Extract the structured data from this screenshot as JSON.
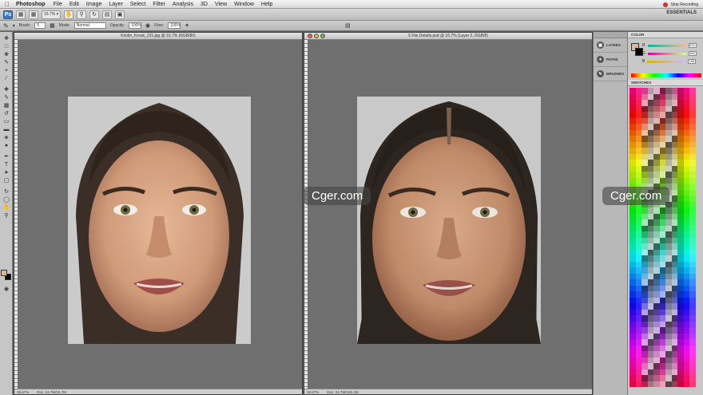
{
  "menubar": {
    "app_name": "Photoshop",
    "items": [
      "File",
      "Edit",
      "Image",
      "Layer",
      "Select",
      "Filter",
      "Analysis",
      "3D",
      "View",
      "Window",
      "Help"
    ],
    "recording_label": "Stop Recording"
  },
  "appbar": {
    "logo": "Ps",
    "zoom": "16.7%",
    "workspace": "ESSENTIALS"
  },
  "optionsbar": {
    "brush_label": "Brush:",
    "brush_size": "9",
    "mode_label": "Mode:",
    "mode_value": "Normal",
    "opacity_label": "Opacity:",
    "opacity_value": "100%",
    "flow_label": "Flow:",
    "flow_value": "100%"
  },
  "doc_left": {
    "title": "Kristin_Kreuk_131.jpg @ 16.7% (RGB/8#)",
    "zoom": "16.67%",
    "doc_info": "Doc: 24.7M/24.7M"
  },
  "doc_right": {
    "title": "5 File Details.psd @ 16.7% (Layer 2, RGB/8)",
    "zoom": "16.67%",
    "doc_info": "Doc: 24.7M/165.1M"
  },
  "dock": {
    "items": [
      {
        "label": "LAYERS",
        "icon": "layers-icon"
      },
      {
        "label": "PATHS",
        "icon": "paths-icon"
      },
      {
        "label": "BRUSHES",
        "icon": "brushes-icon"
      }
    ]
  },
  "color_panel": {
    "tab": "COLOR",
    "r_label": "R",
    "g_label": "G",
    "b_label": "B",
    "r_value": "213",
    "g_value": "183",
    "b_value": "155",
    "fg_color": "#d5b79b"
  },
  "swatches_panel": {
    "tab": "SWATCHES"
  },
  "watermark": {
    "text": "Cger.com"
  }
}
